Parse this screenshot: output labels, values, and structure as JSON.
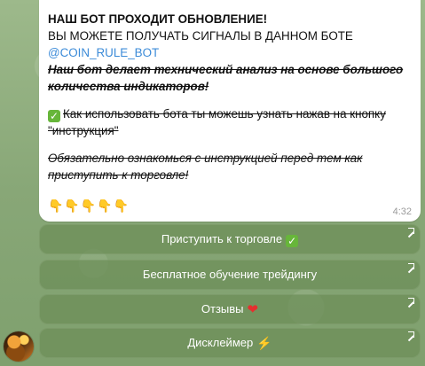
{
  "message": {
    "line1": "НАШ БОТ ПРОХОДИТ ОБНОВЛЕНИЕ!",
    "line2": "ВЫ МОЖЕТЕ ПОЛУЧАТЬ СИГНАЛЫ В ДАННОМ БОТЕ",
    "link": "@COIN_RULE_BOT",
    "italic1": "Наш бот делает технический анализ на основе большого",
    "italic2": "количества индикаторов!",
    "instruction1": "Как использовать бота ты можешь узнать нажав на кнопку",
    "instruction2": "\"инструкция\"",
    "warning1": "Обязательно ознакомься с инструкцией перед тем как",
    "warning2": "приступить к торговле!",
    "hands": "👇👇👇👇👇",
    "time": "4:32"
  },
  "buttons": [
    {
      "label": "Приступить к торговле",
      "icon": "check-icon"
    },
    {
      "label": "Бесплатное обучение трейдингу"
    },
    {
      "label": "Отзывы",
      "icon": "heart-icon"
    },
    {
      "label": "Дисклеймер",
      "icon": "lightning-icon"
    }
  ],
  "avatar": {
    "name": "avatar"
  },
  "colors": {
    "link": "#3c8bd8",
    "buttonBg": "#6c8e58",
    "check": "#67b63a",
    "heart": "#e52f2f",
    "bolt": "#f2c12e"
  }
}
